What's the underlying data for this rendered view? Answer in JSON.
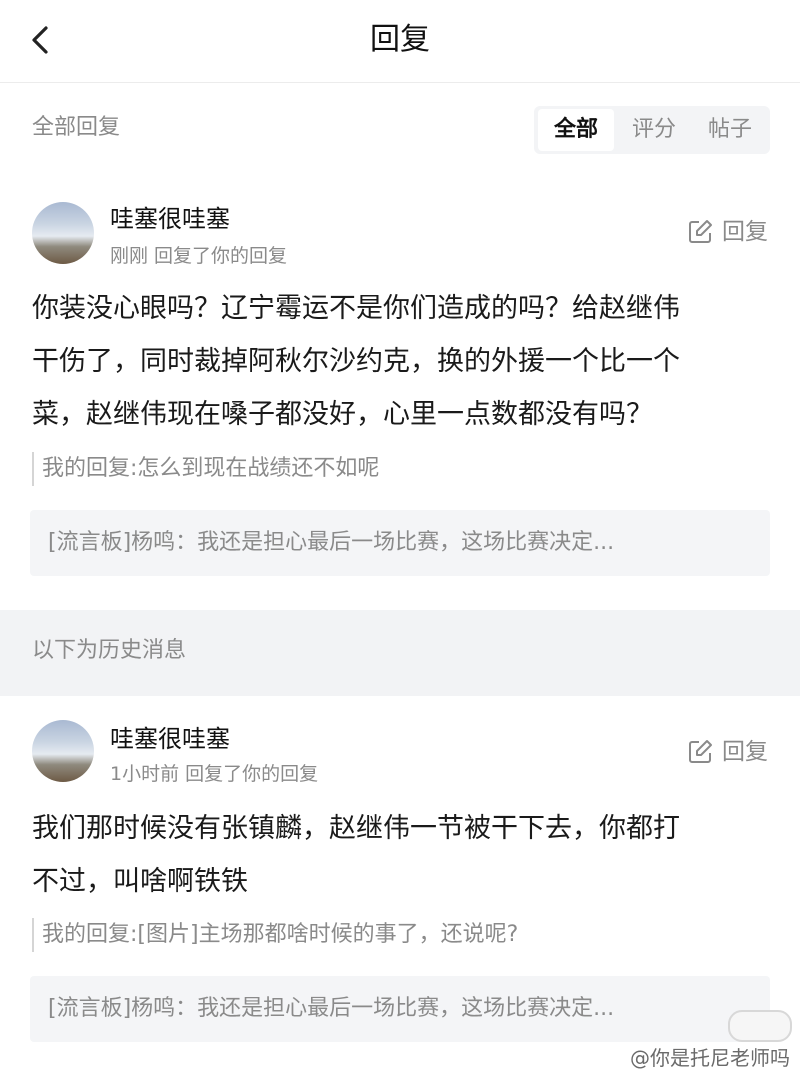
{
  "header": {
    "title": "回复",
    "back_icon": "chevron-left-icon"
  },
  "filter": {
    "section_label": "全部回复",
    "tabs": [
      {
        "label": "全部",
        "active": true
      },
      {
        "label": "评分",
        "active": false
      },
      {
        "label": "帖子",
        "active": false
      }
    ]
  },
  "replies": [
    {
      "username": "哇塞很哇塞",
      "meta": "刚刚 回复了你的回复",
      "reply_label": "回复",
      "content_lines": [
        "你装没心眼吗？辽宁霉运不是你们造成的吗？给赵继伟",
        "干伤了，同时裁掉阿秋尔沙约克，换的外援一个比一个",
        "菜，赵继伟现在嗓子都没好，心里一点数都没有吗？"
      ],
      "my_reply": "我的回复:怎么到现在战绩还不如呢",
      "source": "[流言板]杨鸣：我还是担心最后一场比赛，这场比赛决定..."
    },
    {
      "username": "哇塞很哇塞",
      "meta": "1小时前 回复了你的回复",
      "reply_label": "回复",
      "content_lines": [
        "我们那时候没有张镇麟，赵继伟一节被干下去，你都打",
        "不过，叫啥啊铁铁"
      ],
      "my_reply": "我的回复:[图片]主场那都啥时候的事了，还说呢?",
      "source": "[流言板]杨鸣：我还是担心最后一场比赛，这场比赛决定..."
    }
  ],
  "history_label": "以下为历史消息",
  "watermark": "@你是托尼老师吗",
  "colors": {
    "muted": "#8a8a8a",
    "text": "#1a1a1a",
    "panel": "#f4f5f7",
    "divider": "#f2f3f5"
  }
}
